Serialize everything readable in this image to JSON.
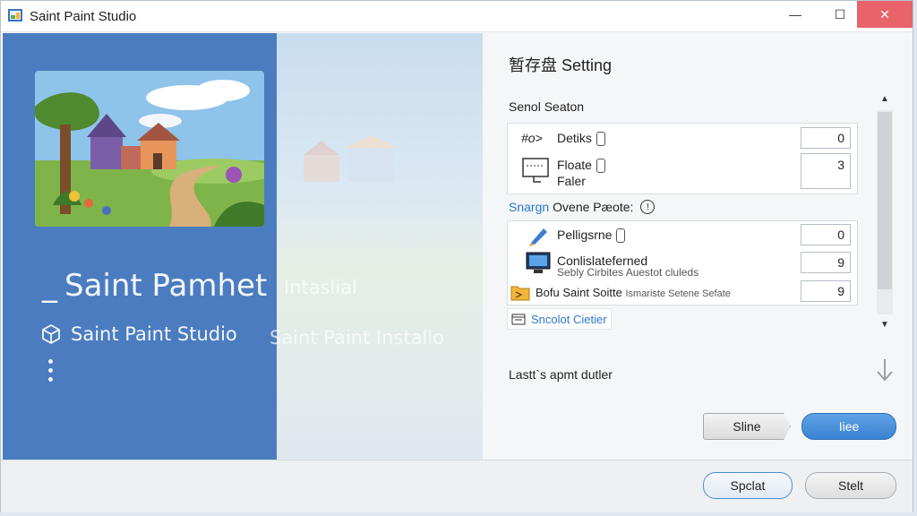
{
  "window": {
    "title": "Saint Paint Studio",
    "controls": {
      "minimize": "—",
      "maximize": "☐",
      "close": "✕"
    }
  },
  "hero": {
    "title": "Saint Pamhet",
    "title_prefix": "_",
    "subtitle": "Saint Paint Studio",
    "ghost_title": "Intaslial",
    "ghost_subtitle": "Saint Paint Installo",
    "accent_color": "#4b7cc0"
  },
  "settings": {
    "title": "暂存盘 Setting",
    "section_title": "Senol Seaton",
    "group1": [
      {
        "icon": "brush-icon",
        "label": "Detiks",
        "icon_text": "#o>",
        "value": "0"
      },
      {
        "icon": "monitor-icon",
        "label": "Floate",
        "label2": "Faler",
        "value": "3"
      }
    ],
    "section2": {
      "accent": "Snargn",
      "label": "Ovene Pæote:"
    },
    "group2": [
      {
        "icon": "pencil-icon",
        "label": "Pelligsrne",
        "value": "0"
      },
      {
        "icon": "computer-icon",
        "label": "Conlislateferned",
        "detail": "Sebly Cirbites Auestot cluleds",
        "value": "9"
      },
      {
        "icon": "folder-icon",
        "label": "Bofu Saint Soitte",
        "detail": "Ismariste Setene Sefate",
        "value": "9"
      }
    ],
    "link": "Sncolot Cietier",
    "last_line": "Lastt`s apmt dutler"
  },
  "buttons": {
    "skip": "Sline",
    "primary": "Iiee",
    "footer_secondary": "Spclat",
    "footer_cancel": "Stelt"
  }
}
